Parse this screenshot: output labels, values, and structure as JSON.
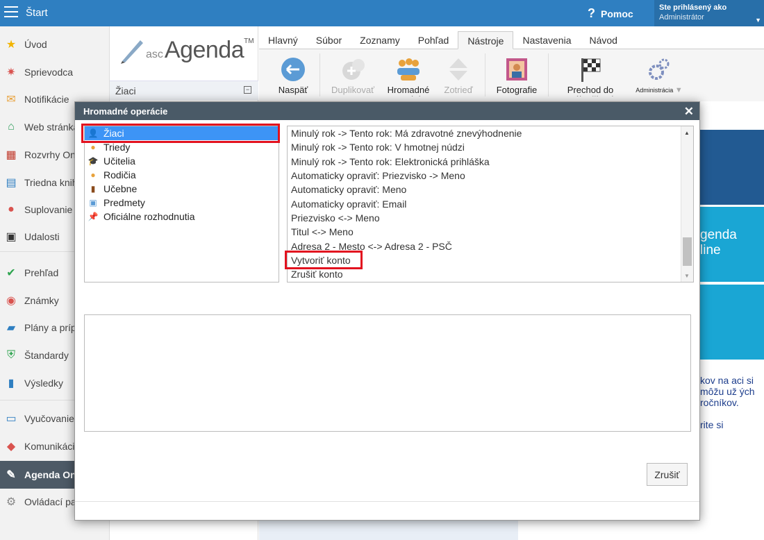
{
  "topbar": {
    "start_label": "Štart",
    "help_label": "Pomoc",
    "user_prefix": "Ste prihlásený ako",
    "user_role": "Administrátor"
  },
  "sidebar": {
    "items": [
      {
        "label": "Úvod",
        "icon": "star-icon"
      },
      {
        "label": "Sprievodca",
        "icon": "magic-wand-icon"
      },
      {
        "label": "Notifikácie",
        "icon": "envelope-icon"
      },
      {
        "label": "Web stránka",
        "icon": "home-icon"
      },
      {
        "label": "Rozvrhy Online",
        "icon": "calendar-grid-icon"
      },
      {
        "label": "Triedna kniha",
        "icon": "book-icon"
      },
      {
        "label": "Suplovanie",
        "icon": "person-icon"
      },
      {
        "label": "Udalosti",
        "icon": "calendar-icon"
      },
      {
        "label": "Prehľad",
        "icon": "check-circle-icon"
      },
      {
        "label": "Známky",
        "icon": "grades-icon"
      },
      {
        "label": "Plány a prípravy",
        "icon": "briefcase-icon"
      },
      {
        "label": "Štandardy",
        "icon": "shield-check-icon"
      },
      {
        "label": "Výsledky",
        "icon": "bar-chart-icon"
      },
      {
        "label": "Vyučovanie",
        "icon": "open-book-icon"
      },
      {
        "label": "Komunikácia",
        "icon": "chat-icon"
      },
      {
        "label": "Agenda Online",
        "icon": "agenda-logo-icon"
      },
      {
        "label": "Ovládací panel",
        "icon": "gear-icon"
      }
    ]
  },
  "logo": {
    "prefix": "asc",
    "name": "Agenda",
    "tm": "TM"
  },
  "section": {
    "label": "Žiaci"
  },
  "ribbon": {
    "tabs": [
      "Hlavný",
      "Súbor",
      "Zoznamy",
      "Pohľad",
      "Nástroje",
      "Nastavenia",
      "Návod"
    ],
    "active_tab": "Nástroje",
    "buttons": {
      "back": "Naspäť",
      "duplicate": "Duplikovať",
      "bulk_ops": "Hromadné operácie",
      "sort": "Zotrieď",
      "photos": "Fotografie",
      "year_transition": "Prechod do nového šk.roku",
      "administration": "Administrácia"
    }
  },
  "background": {
    "tile_text": "genda line",
    "right_text": "kov na aci si môžu už ých ročníkov.",
    "right_text2": "rite si"
  },
  "dialog": {
    "title": "Hromadné operácie",
    "categories": [
      {
        "label": "Žiaci",
        "icon": "student-icon",
        "selected": true
      },
      {
        "label": "Triedy",
        "icon": "class-icon",
        "selected": false
      },
      {
        "label": "Učitelia",
        "icon": "graduation-cap-icon",
        "selected": false
      },
      {
        "label": "Rodičia",
        "icon": "parents-icon",
        "selected": false
      },
      {
        "label": "Učebne",
        "icon": "door-icon",
        "selected": false
      },
      {
        "label": "Predmety",
        "icon": "subject-icon",
        "selected": false
      },
      {
        "label": "Oficiálne rozhodnutia",
        "icon": "pin-icon",
        "selected": false
      }
    ],
    "operations": [
      "Minulý rok -> Tento rok: Má zdravotné znevýhodnenie",
      "Minulý rok -> Tento rok: V hmotnej núdzi",
      "Minulý rok -> Tento rok: Elektronická prihláška",
      "Automaticky opraviť: Priezvisko -> Meno",
      "Automaticky opraviť: Meno",
      "Automaticky opraviť: Email",
      "Priezvisko <-> Meno",
      "Titul <-> Meno",
      "Adresa 2 - Mesto <-> Adresa 2 - PSČ",
      "Vytvoriť konto",
      "Zrušiť konto"
    ],
    "cancel_label": "Zrušiť"
  },
  "colors": {
    "topbar": "#2f7fc1",
    "dialog_title": "#4a5a67",
    "selection": "#3d94f6",
    "highlight": "#e2121f"
  }
}
